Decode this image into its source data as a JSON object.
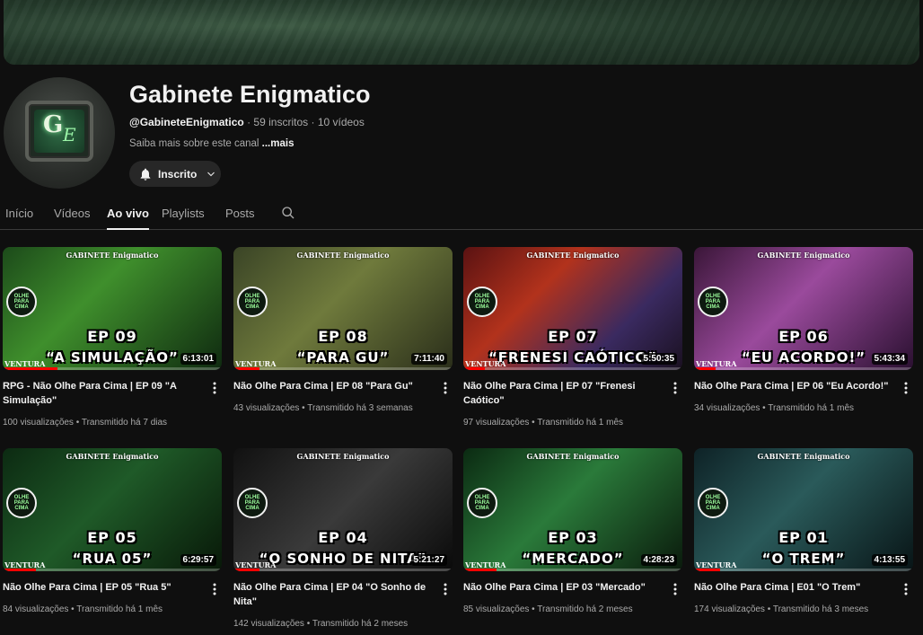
{
  "channel": {
    "name": "Gabinete Enigmatico",
    "handle": "@GabineteEnigmatico",
    "separator": "·",
    "subscribers": "59 inscritos",
    "videos_count": "10 vídeos",
    "about": "Saiba mais sobre este canal",
    "about_more": "...mais",
    "subscribe_label": "Inscrito",
    "avatar_letters": "G",
    "avatar_letters2": "E"
  },
  "tabs": [
    {
      "label": "Início"
    },
    {
      "label": "Vídeos"
    },
    {
      "label": "Ao vivo"
    },
    {
      "label": "Playlists"
    },
    {
      "label": "Posts"
    }
  ],
  "videos": [
    {
      "title": "RPG - Não Olhe Para Cima | EP 09 \"A Simulação\"",
      "views": "100 visualizações",
      "when": "Transmitido há 7 dias",
      "duration": "6:13:01",
      "ep": "EP 09",
      "sub": "“A SIMULAÇÃO”",
      "progress": 0.25,
      "bg": "linear-gradient(135deg,#1c4a1a 0%,#3f8f2c 40%,#0f2a10 100%)"
    },
    {
      "title": "Não Olhe Para Cima | EP 08 \"Para Gu\"",
      "views": "43 visualizações",
      "when": "Transmitido há 3 semanas",
      "duration": "7:11:40",
      "ep": "EP 08",
      "sub": "“PARA GU”",
      "progress": 0.12,
      "bg": "linear-gradient(135deg,#3a4426 0%,#6f7a3c 45%,#2a2e1a 100%)"
    },
    {
      "title": "Não Olhe Para Cima | EP 07 \"Frenesi Caótico\"",
      "views": "97 visualizações",
      "when": "Transmitido há 1 mês",
      "duration": "5:50:35",
      "ep": "EP 07",
      "sub": "“FRENESI CAÓTICO”",
      "progress": 0.1,
      "bg": "linear-gradient(135deg,#5a1212 0%,#b2321c 35%,#3a2a60 70%,#1a1020 100%)"
    },
    {
      "title": "Não Olhe Para Cima | EP 06 \"Eu Acordo!\"",
      "views": "34 visualizações",
      "when": "Transmitido há 1 mês",
      "duration": "5:43:34",
      "ep": "EP 06",
      "sub": "“EU ACORDO!”",
      "progress": 0.1,
      "bg": "linear-gradient(135deg,#3a1638 0%,#9a4a9c 45%,#2a1030 100%)"
    },
    {
      "title": "Não Olhe Para Cima | EP 05 \"Rua 5\"",
      "views": "84 visualizações",
      "when": "Transmitido há 1 mês",
      "duration": "6:29:57",
      "ep": "EP 05",
      "sub": "“RUA 05”",
      "progress": 0.15,
      "bg": "linear-gradient(135deg,#0c2a12 0%,#1f5a28 45%,#081808 100%)"
    },
    {
      "title": "Não Olhe Para Cima | EP 04 \"O Sonho de Nita\"",
      "views": "142 visualizações",
      "when": "Transmitido há 2 meses",
      "duration": "5:21:27",
      "ep": "EP 04",
      "sub": "“O SONHO DE NITA”",
      "progress": 0.12,
      "bg": "linear-gradient(135deg,#111111 0%,#3a3a3a 50%,#0a0a0a 100%)"
    },
    {
      "title": "Não Olhe Para Cima | EP 03 \"Mercado\"",
      "views": "85 visualizações",
      "when": "Transmitido há 2 meses",
      "duration": "4:28:23",
      "ep": "EP 03",
      "sub": "“MERCADO”",
      "progress": 0.15,
      "bg": "linear-gradient(135deg,#0b2a12 0%,#2a7a3a 45%,#0a1a0c 100%)"
    },
    {
      "title": "Não Olhe Para Cima | E01 \"O Trem\"",
      "views": "174 visualizações",
      "when": "Transmitido há 3 meses",
      "duration": "4:13:55",
      "ep": "EP 01",
      "sub": "“O TREM”",
      "progress": 0.12,
      "bg": "linear-gradient(135deg,#0e2226 0%,#2a5a5a 45%,#081416 100%)"
    }
  ],
  "thumb_brand": "GABINETE Enigmatico",
  "thumb_badge": "OLHE PARA CIMA",
  "thumb_ventura": "VENTURA",
  "icons": [
    "bell-icon",
    "chevron-down-icon",
    "search-icon",
    "more-vert-icon"
  ]
}
